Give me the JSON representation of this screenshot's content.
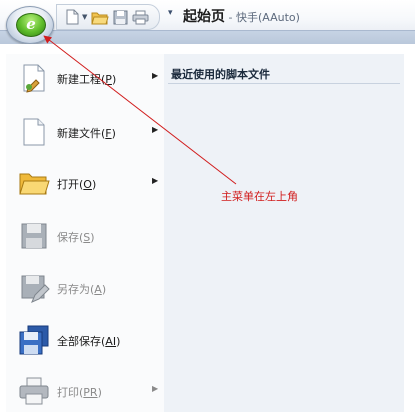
{
  "window": {
    "title": "起始页",
    "title_separator": " - ",
    "app_name": "快手(AAuto)"
  },
  "app_button": {
    "glyph": "e"
  },
  "quick_access": {
    "buttons": [
      "new-icon",
      "open-folder-icon",
      "save-icon",
      "print-icon"
    ],
    "dropdown_glyph": "▾"
  },
  "menu": {
    "items": [
      {
        "label": "新建工程",
        "accel": "P",
        "submenu": true,
        "enabled": true
      },
      {
        "label": "新建文件",
        "accel": "F",
        "submenu": true,
        "enabled": true
      },
      {
        "label": "打开",
        "accel": "O",
        "submenu": true,
        "enabled": true
      },
      {
        "label": "保存",
        "accel": "S",
        "submenu": false,
        "enabled": false
      },
      {
        "label": "另存为",
        "accel": "A",
        "submenu": false,
        "enabled": false
      },
      {
        "label": "全部保存",
        "accel": "AI",
        "submenu": false,
        "enabled": true
      },
      {
        "label": "打印",
        "accel": "PR",
        "submenu": true,
        "enabled": false
      }
    ],
    "recent": {
      "title": "最近使用的脚本文件",
      "files": []
    }
  },
  "annotation": {
    "text": "主菜单在左上角",
    "color": "#d11d1d"
  },
  "colors": {
    "accent": "#5fbd2b",
    "panel": "#eef2f7",
    "annotation": "#d11d1d"
  }
}
